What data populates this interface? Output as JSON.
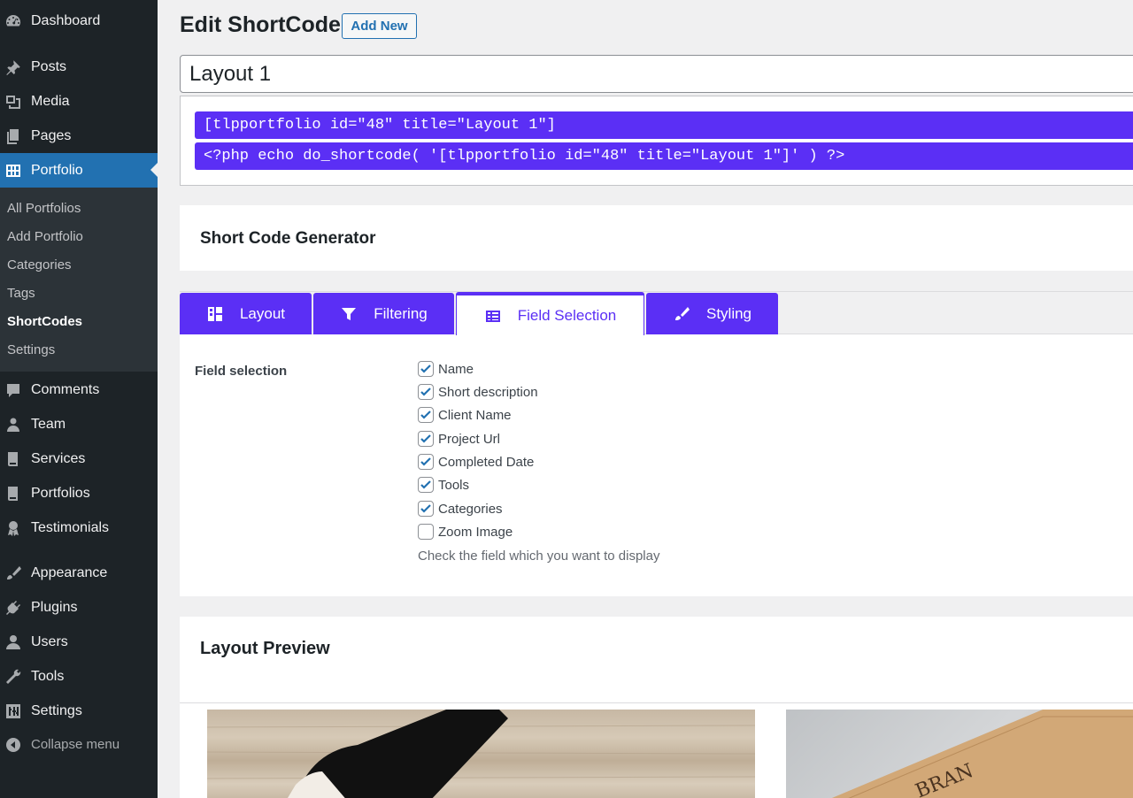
{
  "sidebar": {
    "menu": [
      {
        "label": "Dashboard",
        "icon": "dashboard-icon"
      },
      {
        "label": "Posts",
        "icon": "pin-icon"
      },
      {
        "label": "Media",
        "icon": "media-icon"
      },
      {
        "label": "Pages",
        "icon": "pages-icon"
      },
      {
        "label": "Portfolio",
        "icon": "portfolio-grid-icon",
        "current": true
      },
      {
        "label": "Comments",
        "icon": "comment-icon"
      },
      {
        "label": "Team",
        "icon": "team-icon"
      },
      {
        "label": "Services",
        "icon": "book-icon"
      },
      {
        "label": "Portfolios",
        "icon": "book-icon"
      },
      {
        "label": "Testimonials",
        "icon": "award-icon"
      },
      {
        "label": "Appearance",
        "icon": "brush-icon"
      },
      {
        "label": "Plugins",
        "icon": "plug-icon"
      },
      {
        "label": "Users",
        "icon": "user-icon"
      },
      {
        "label": "Tools",
        "icon": "wrench-icon"
      },
      {
        "label": "Settings",
        "icon": "sliders-icon"
      },
      {
        "label": "Collapse menu",
        "icon": "collapse-icon"
      }
    ],
    "submenu": [
      {
        "label": "All Portfolios"
      },
      {
        "label": "Add Portfolio"
      },
      {
        "label": "Categories"
      },
      {
        "label": "Tags"
      },
      {
        "label": "ShortCodes",
        "active": true
      },
      {
        "label": "Settings"
      }
    ]
  },
  "header": {
    "title": "Edit ShortCode",
    "add_new": "Add New"
  },
  "post_title": "Layout 1",
  "shortcode": {
    "line1": "[tlpportfolio id=\"48\" title=\"Layout 1\"]",
    "line2": "<?php echo do_shortcode( '[tlpportfolio id=\"48\" title=\"Layout 1\"]' ) ?>"
  },
  "generator": {
    "title": "Short Code Generator"
  },
  "tabs": [
    {
      "label": "Layout",
      "icon": "layout-icon"
    },
    {
      "label": "Filtering",
      "icon": "filter-icon"
    },
    {
      "label": "Field Selection",
      "icon": "table-icon",
      "active": true
    },
    {
      "label": "Styling",
      "icon": "brush-icon"
    }
  ],
  "field_selection": {
    "label": "Field selection",
    "fields": [
      {
        "label": "Name",
        "checked": true
      },
      {
        "label": "Short description",
        "checked": true
      },
      {
        "label": "Client Name",
        "checked": true
      },
      {
        "label": "Project Url",
        "checked": true
      },
      {
        "label": "Completed Date",
        "checked": true
      },
      {
        "label": "Tools",
        "checked": true
      },
      {
        "label": "Categories",
        "checked": true
      },
      {
        "label": "Zoom Image",
        "checked": false
      }
    ],
    "description": "Check the field which you want to display"
  },
  "preview": {
    "title": "Layout Preview",
    "image2_text": "BRAN"
  },
  "colors": {
    "accent": "#5b2ff5",
    "wp_blue": "#2271b1",
    "sidebar_bg": "#1d2327"
  }
}
